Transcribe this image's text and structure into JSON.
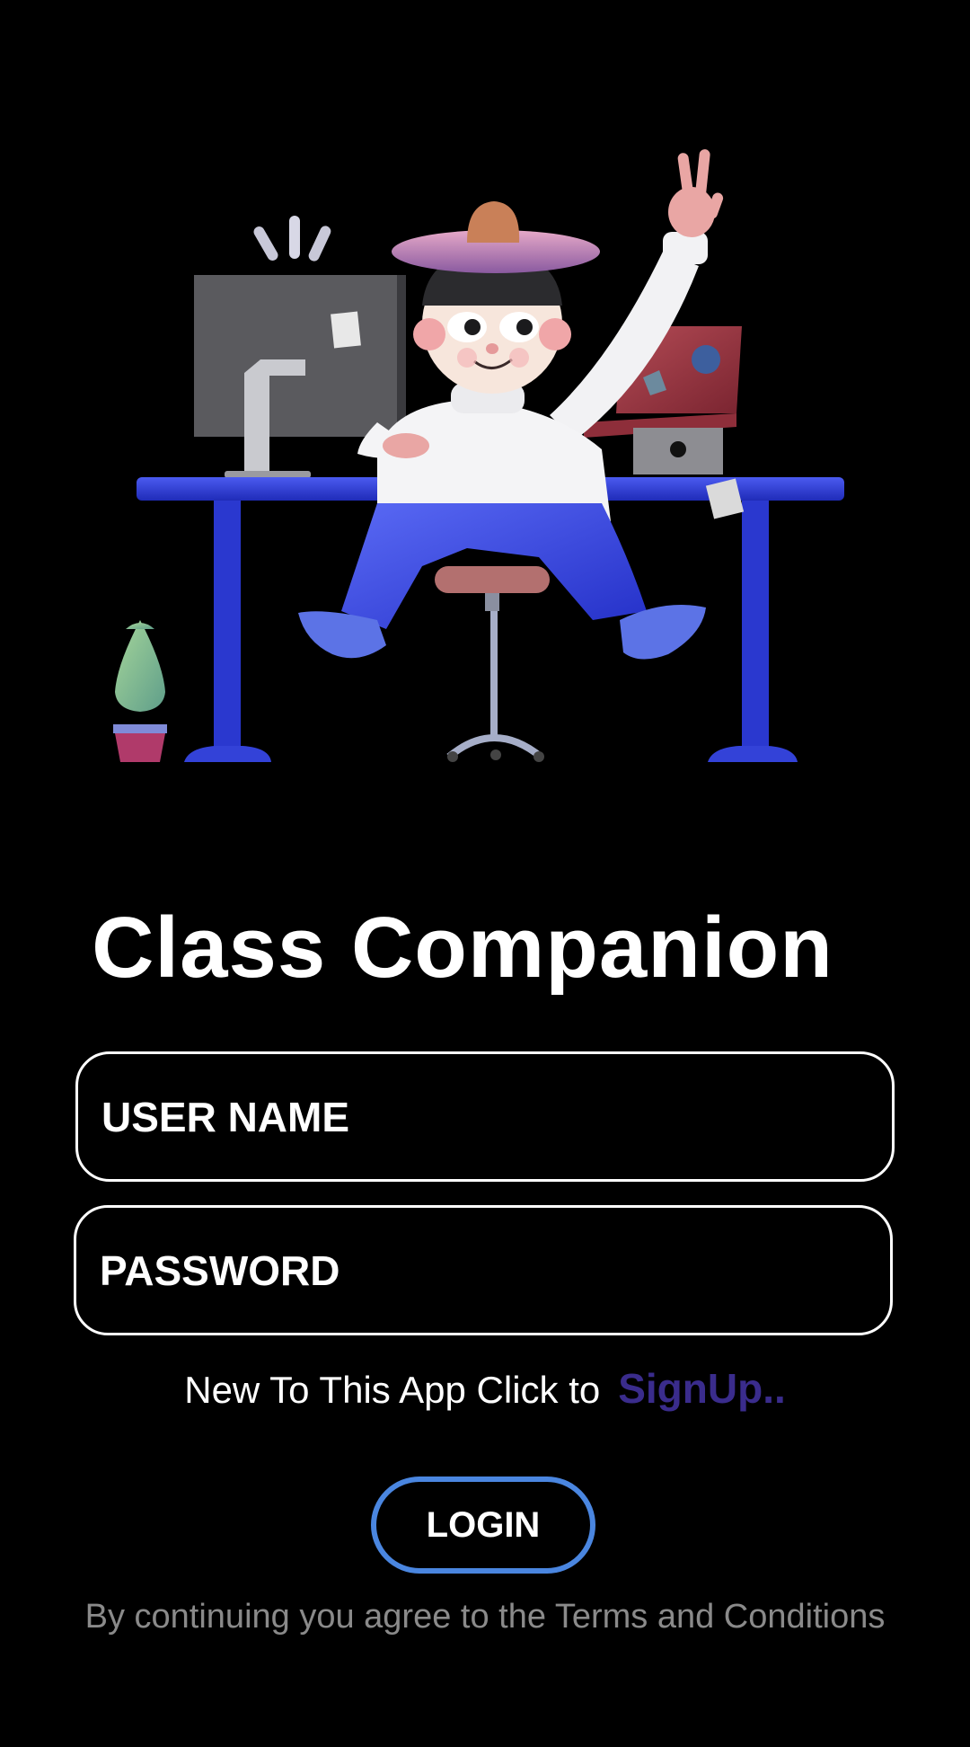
{
  "app": {
    "title": "Class Companion"
  },
  "hero": {
    "illustration": "person-at-desk-illustration"
  },
  "form": {
    "username_placeholder": "USER NAME",
    "password_placeholder": "PASSWORD"
  },
  "signup": {
    "prompt": "New To This App Click to",
    "link_label": "SignUp.."
  },
  "login": {
    "label": "LOGIN"
  },
  "terms": {
    "text": "By continuing you agree to the Terms and Conditions"
  },
  "colors": {
    "background": "#000000",
    "text": "#ffffff",
    "signup_link": "#3a2c8c",
    "login_border": "#4a86e0",
    "terms_text": "#8a8a8a",
    "desk": "#2f3fd6"
  }
}
